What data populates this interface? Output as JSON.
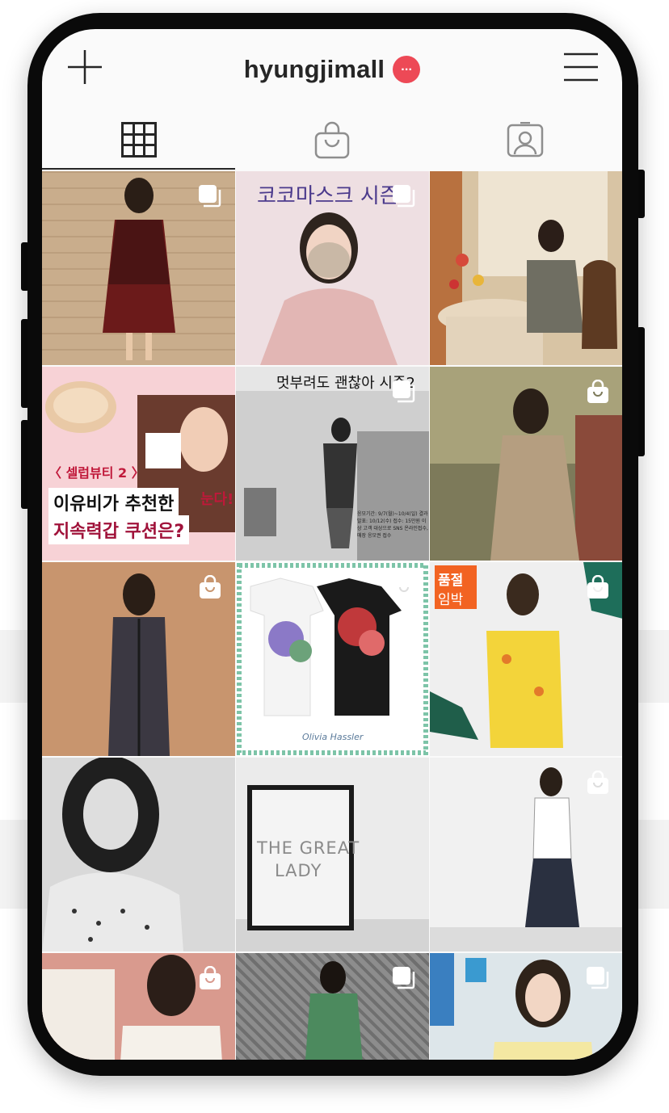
{
  "header": {
    "add_icon": "plus-icon",
    "username": "hyungjimall",
    "notification_dots": "...",
    "menu_icon": "hamburger-menu-icon"
  },
  "tabs": [
    {
      "icon": "grid-icon",
      "active": true
    },
    {
      "icon": "shopping-bag-icon",
      "active": false
    },
    {
      "icon": "tagged-person-icon",
      "active": false
    }
  ],
  "posts": {
    "p2_text": "코코마스크 시즌",
    "p4_label": "〈 셀럽뷰티 2 〉",
    "p4_line1": "이유비가 추천한",
    "p4_line2": "지속력갑 쿠션은?",
    "p4_side": "눈다!",
    "p5_text": "멋부려도 괜찮아 시즌2",
    "p5_info": "응모기간: 9/7(월)~10/4(일) 결과발표: 10/12(수) 접수: 15만원 이상 고객 대상으로 SNS 온라인접수, 매장 응모권 접수",
    "p8_brand": "Olivia Hassler",
    "p9_badge_line1": "품절",
    "p9_badge_line2": "임박",
    "p11_line1": "THE GREAT",
    "p11_line2": "LADY"
  },
  "colors": {
    "accent": "#ed4956",
    "text": "#262626",
    "sold_out_badge": "#f26322"
  }
}
